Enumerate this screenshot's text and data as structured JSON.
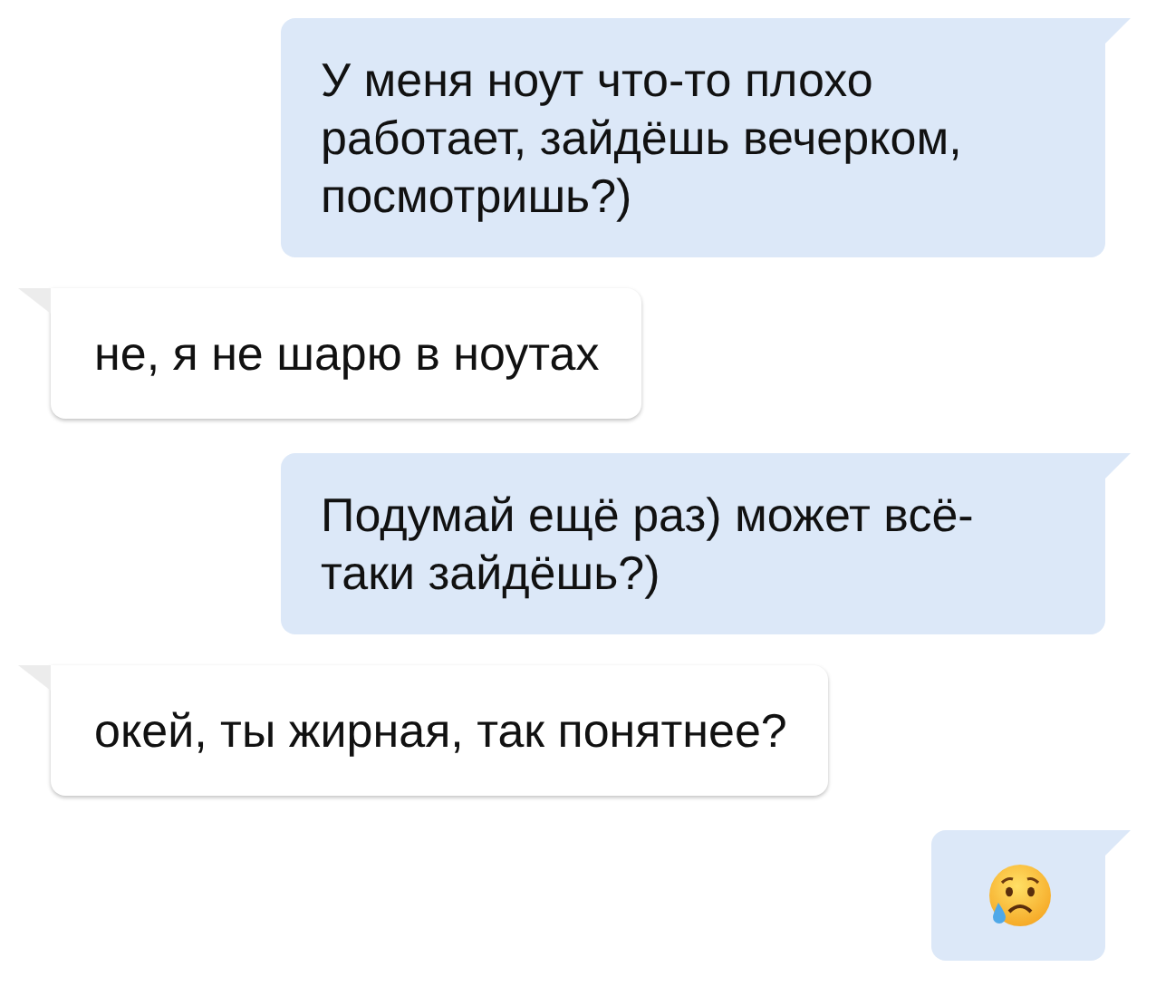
{
  "messages": [
    {
      "outgoing": true,
      "kind": "text",
      "text": "У меня ноут что-то плохо работает, зайдёшь вечерком, посмотришь?)"
    },
    {
      "outgoing": false,
      "kind": "text",
      "text": "не, я не шарю в ноутах"
    },
    {
      "outgoing": true,
      "kind": "text",
      "text": "Подумай ещё раз) может всё-таки зайдёшь?)"
    },
    {
      "outgoing": false,
      "kind": "text",
      "text": "окей, ты жирная, так понятнее?"
    },
    {
      "outgoing": true,
      "kind": "emoji"
    }
  ]
}
